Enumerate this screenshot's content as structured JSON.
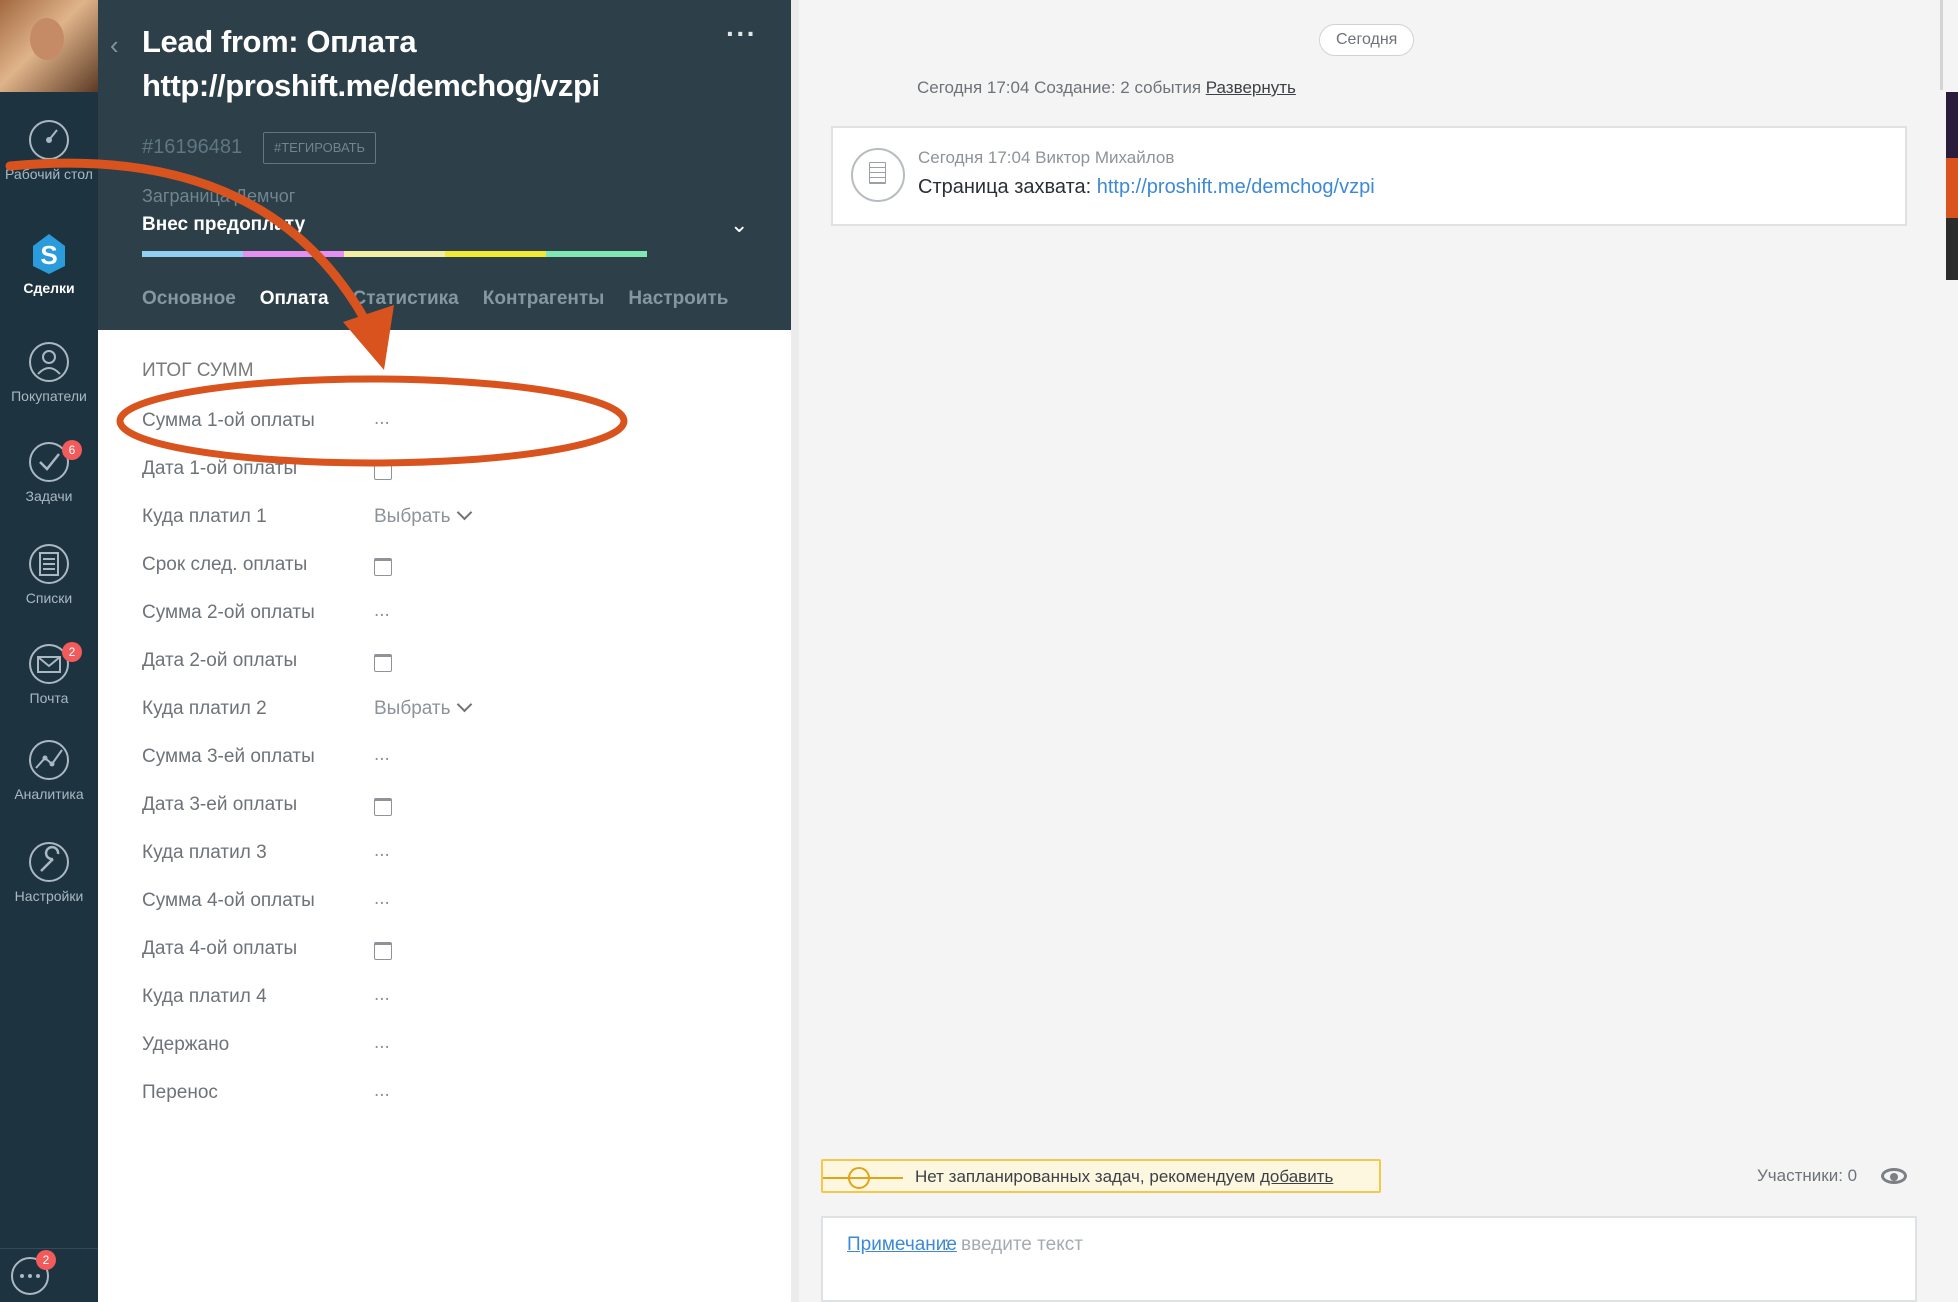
{
  "sidebar": {
    "items": [
      {
        "label": "Рабочий стол",
        "icon": "dashboard-icon",
        "active": false
      },
      {
        "label": "Сделки",
        "icon": "deals-icon",
        "active": true
      },
      {
        "label": "Покупатели",
        "icon": "customers-icon",
        "active": false
      },
      {
        "label": "Задачи",
        "icon": "tasks-icon",
        "badge": "6",
        "active": false
      },
      {
        "label": "Списки",
        "icon": "lists-icon",
        "active": false
      },
      {
        "label": "Почта",
        "icon": "mail-icon",
        "badge": "2",
        "active": false
      },
      {
        "label": "Аналитика",
        "icon": "analytics-icon",
        "active": false
      },
      {
        "label": "Настройки",
        "icon": "settings-icon",
        "active": false
      }
    ],
    "chat_badge": "2"
  },
  "lead": {
    "title": "Lead from: Оплата http://proshift.me/demchog/vzpi",
    "id": "#16196481",
    "tag_button": "#ТЕГИРОВАТЬ",
    "company": "Заграница Демчог",
    "status": "Внес предоплату",
    "pipeline_colors": [
      "#8fd0f3",
      "#e58ff0",
      "#f2f0a0",
      "#f3e836",
      "#7ee7b3",
      "#2d3f48"
    ]
  },
  "tabs": [
    "Основное",
    "Оплата",
    "Статистика",
    "Контрагенты",
    "Настроить"
  ],
  "active_tab": "Оплата",
  "section_title": "ИТОГ СУММ",
  "fields": [
    {
      "label": "Сумма 1-ой оплаты",
      "type": "text",
      "value": "..."
    },
    {
      "label": "Дата 1-ой оплаты",
      "type": "date"
    },
    {
      "label": "Куда платил 1",
      "type": "select",
      "value": "Выбрать"
    },
    {
      "label": "Срок след. оплаты",
      "type": "date"
    },
    {
      "label": "Сумма 2-ой оплаты",
      "type": "text",
      "value": "..."
    },
    {
      "label": "Дата 2-ой оплаты",
      "type": "date"
    },
    {
      "label": "Куда платил 2",
      "type": "select",
      "value": "Выбрать"
    },
    {
      "label": "Сумма 3-ей оплаты",
      "type": "text",
      "value": "..."
    },
    {
      "label": "Дата 3-ей оплаты",
      "type": "date"
    },
    {
      "label": "Куда платил 3",
      "type": "text",
      "value": "..."
    },
    {
      "label": "Сумма 4-ой оплаты",
      "type": "text",
      "value": "..."
    },
    {
      "label": "Дата 4-ой оплаты",
      "type": "date"
    },
    {
      "label": "Куда платил 4",
      "type": "text",
      "value": "..."
    },
    {
      "label": "Удержано",
      "type": "text",
      "value": "..."
    },
    {
      "label": "Перенос",
      "type": "text",
      "value": "..."
    }
  ],
  "feed": {
    "today_label": "Сегодня",
    "created_text": "Сегодня 17:04 Создание: 2 события ",
    "expand_link": "Развернуть",
    "note": {
      "meta": "Сегодня 17:04 Виктор Михайлов",
      "label": "Страница захвата: ",
      "link": "http://proshift.me/demchog/vzpi"
    },
    "task_banner": "Нет запланированных задач, рекомендуем ",
    "task_link": "добавить",
    "participants": "Участники: 0",
    "compose_label": "Примечание",
    "compose_sep": ":",
    "compose_placeholder": "введите текст"
  },
  "annotation_color": "#d9531e"
}
